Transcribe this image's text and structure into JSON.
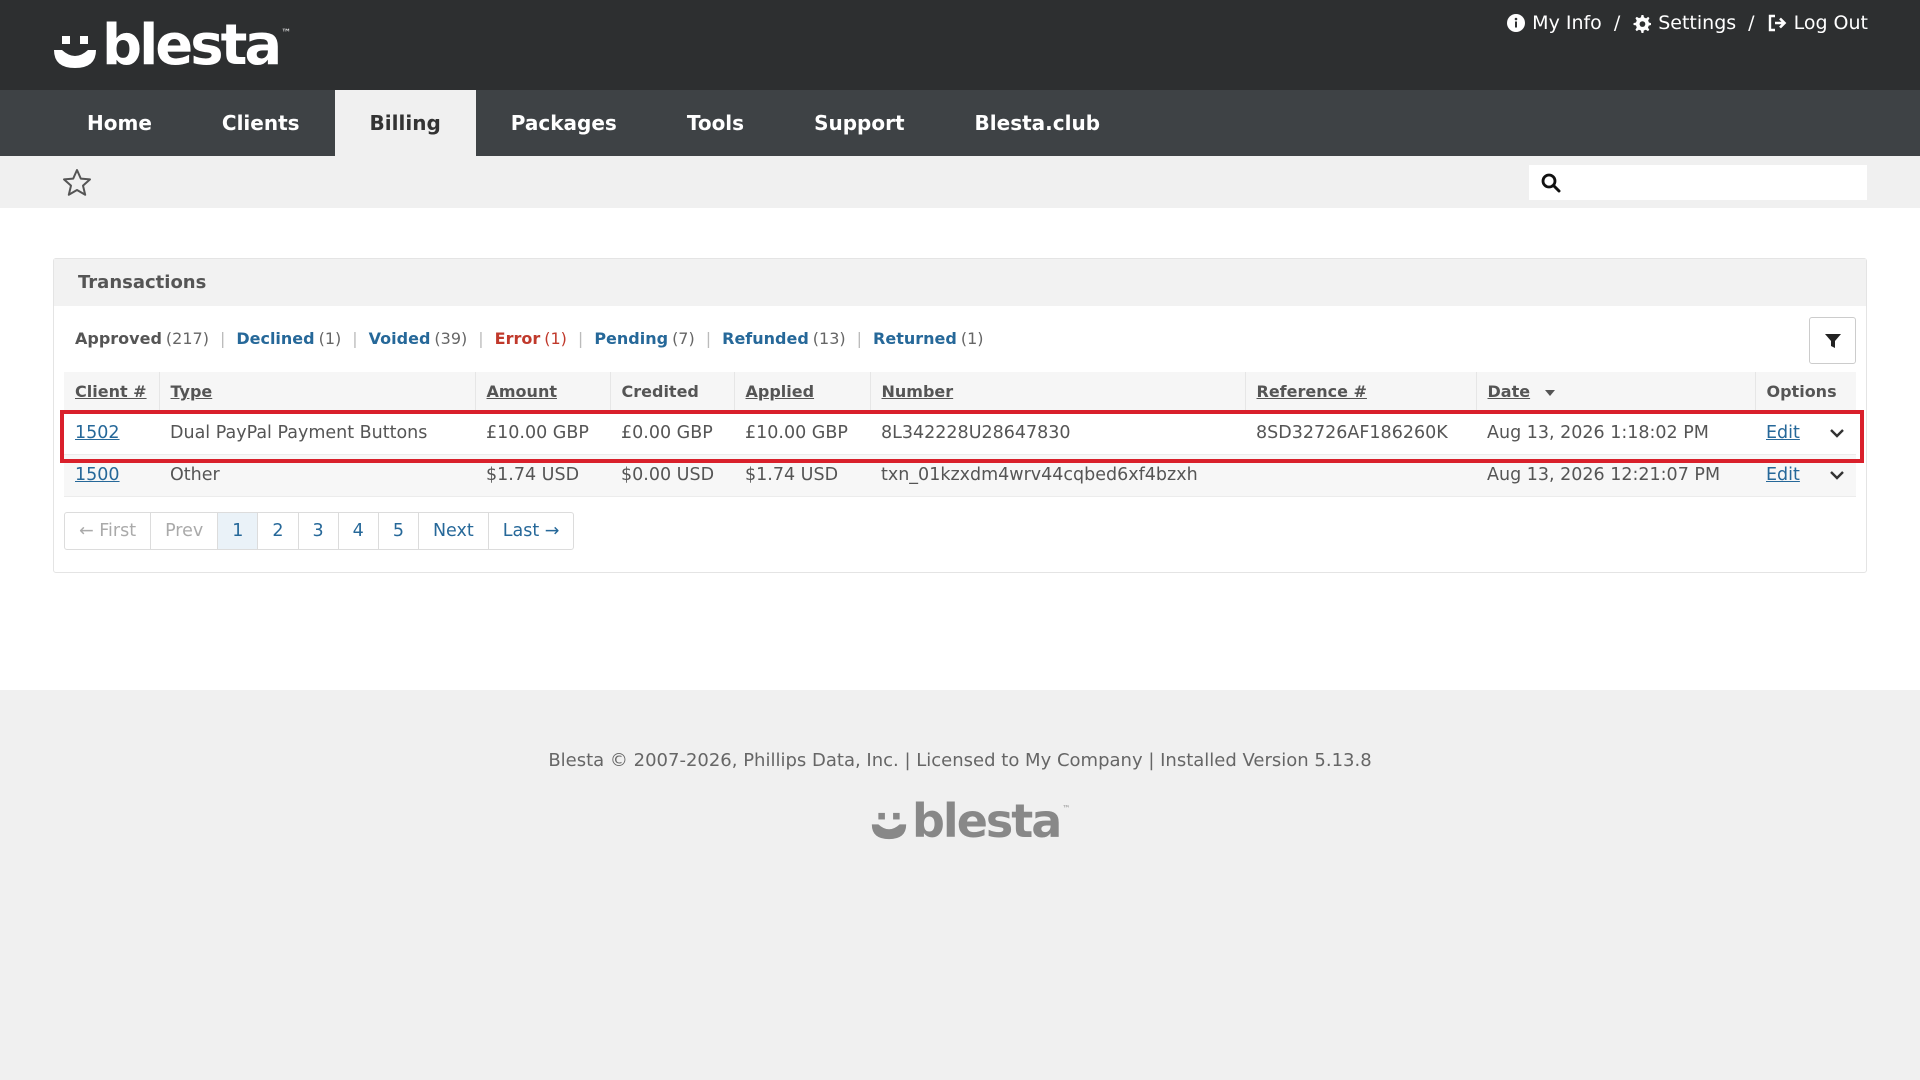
{
  "brand": {
    "name": "blesta",
    "tm": "™"
  },
  "top_links": [
    {
      "label": "My Info",
      "icon": "info-icon"
    },
    {
      "label": "Settings",
      "icon": "gear-icon"
    },
    {
      "label": "Log Out",
      "icon": "logout-icon"
    }
  ],
  "top_sep": "/",
  "nav": [
    {
      "label": "Home",
      "active": false
    },
    {
      "label": "Clients",
      "active": false
    },
    {
      "label": "Billing",
      "active": true
    },
    {
      "label": "Packages",
      "active": false
    },
    {
      "label": "Tools",
      "active": false
    },
    {
      "label": "Support",
      "active": false
    },
    {
      "label": "Blesta.club",
      "active": false
    }
  ],
  "search": {
    "value": "",
    "placeholder": ""
  },
  "panel": {
    "title": "Transactions"
  },
  "statuses": [
    {
      "label": "Approved",
      "count": "(217)",
      "style": "cur"
    },
    {
      "label": "Declined",
      "count": "(1)",
      "style": "blue"
    },
    {
      "label": "Voided",
      "count": "(39)",
      "style": "blue"
    },
    {
      "label": "Error",
      "count": "(1)",
      "style": "red"
    },
    {
      "label": "Pending",
      "count": "(7)",
      "style": "blue"
    },
    {
      "label": "Refunded",
      "count": "(13)",
      "style": "blue"
    },
    {
      "label": "Returned",
      "count": "(1)",
      "style": "blue"
    }
  ],
  "table": {
    "headers": {
      "client": "Client #",
      "type": "Type",
      "amount": "Amount",
      "credited": "Credited",
      "applied": "Applied",
      "number": "Number",
      "reference": "Reference #",
      "date": "Date",
      "options": "Options"
    },
    "rows": [
      {
        "client": "1502",
        "type": "Dual PayPal Payment Buttons",
        "amount": "£10.00 GBP",
        "credited": "£0.00 GBP",
        "applied": "£10.00 GBP",
        "number": "8L342228U28647830",
        "reference": "8SD32726AF186260K",
        "date": "Aug 13, 2026 1:18:02 PM",
        "edit": "Edit"
      },
      {
        "client": "1500",
        "type": "Other",
        "amount": "$1.74 USD",
        "credited": "$0.00 USD",
        "applied": "$1.74 USD",
        "number": "txn_01kzxdm4wrv44cqbed6xf4bzxh",
        "reference": "",
        "date": "Aug 13, 2026 12:21:07 PM",
        "edit": "Edit"
      }
    ]
  },
  "pagination": {
    "first": "← First",
    "prev": "Prev",
    "pages": [
      "1",
      "2",
      "3",
      "4",
      "5"
    ],
    "next": "Next",
    "last": "Last →"
  },
  "footer": {
    "copyright": "Blesta © 2007-2026, Phillips Data, Inc. | Licensed to My Company | Installed Version 5.13.8"
  },
  "colors": {
    "highlight": "#d9202b",
    "link": "#266899",
    "topbar": "#2d2f30",
    "nav": "#3e4245"
  }
}
